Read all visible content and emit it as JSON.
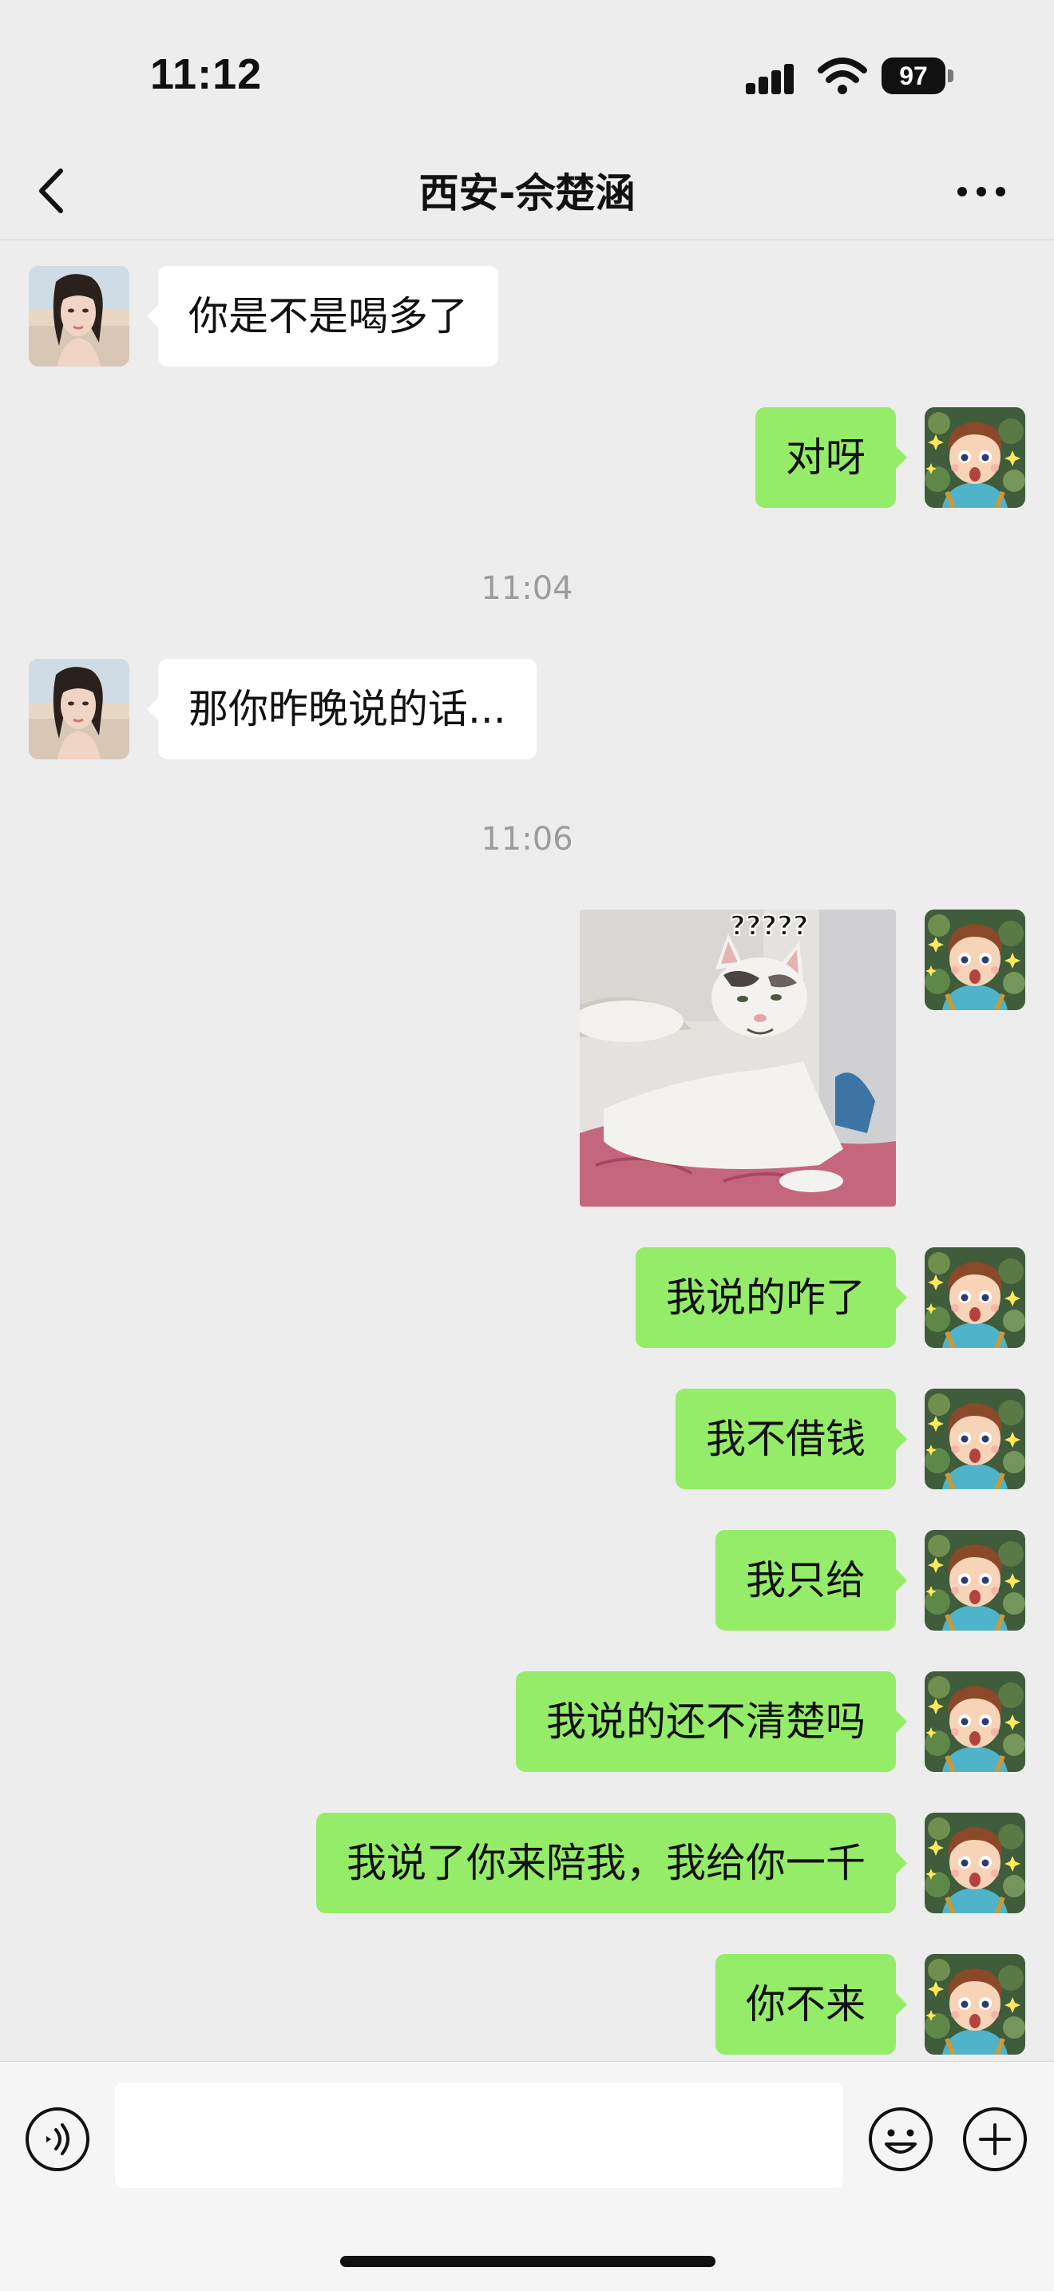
{
  "status_bar": {
    "time": "11:12",
    "battery_level": "97",
    "icons": [
      "signal-icon",
      "wifi-icon",
      "battery-icon"
    ]
  },
  "nav": {
    "title": "西安-佘楚涵",
    "back_icon": "chevron-left-icon",
    "more_icon": "more-dots-icon"
  },
  "messages": [
    {
      "side": "left",
      "text": "你是不是喝多了"
    },
    {
      "side": "right",
      "text": "对呀"
    },
    {
      "type": "time",
      "text": "11:04"
    },
    {
      "side": "left",
      "text": "那你昨晚说的话..."
    },
    {
      "type": "time",
      "text": "11:06"
    },
    {
      "side": "right",
      "type": "sticker",
      "sticker_caption": "?????"
    },
    {
      "side": "right",
      "text": "我说的咋了"
    },
    {
      "side": "right",
      "text": "我不借钱"
    },
    {
      "side": "right",
      "text": "我只给"
    },
    {
      "side": "right",
      "text": "我说的还不清楚吗"
    },
    {
      "side": "right",
      "text": "我说了你来陪我，我给你一千"
    },
    {
      "side": "right",
      "text": "你不来"
    }
  ],
  "input_bar": {
    "value": "",
    "placeholder": "",
    "icons": [
      "voice-icon",
      "emoji-icon",
      "plus-icon"
    ]
  },
  "colors": {
    "background": "#ededed",
    "sent_bubble": "#95ec69",
    "received_bubble": "#ffffff",
    "timestamp": "#9c9c9c"
  }
}
